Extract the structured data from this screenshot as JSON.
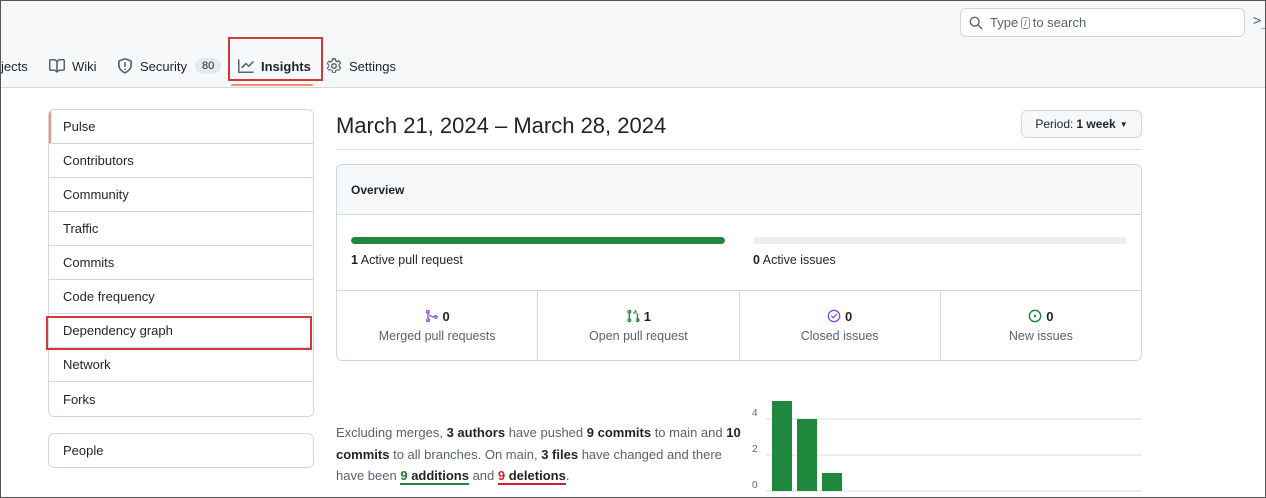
{
  "header": {
    "search": {
      "before": "Type",
      "key": "/",
      "after": "to search"
    },
    "command_glyph": ">_"
  },
  "tabs": [
    {
      "label": "Projects",
      "visible_label": "jects"
    },
    {
      "label": "Wiki"
    },
    {
      "label": "Security",
      "counter": "80"
    },
    {
      "label": "Insights",
      "selected": true
    },
    {
      "label": "Settings"
    }
  ],
  "sidebar": {
    "items": [
      {
        "label": "Pulse",
        "selected": true
      },
      {
        "label": "Contributors"
      },
      {
        "label": "Community"
      },
      {
        "label": "Traffic"
      },
      {
        "label": "Commits"
      },
      {
        "label": "Code frequency"
      },
      {
        "label": "Dependency graph"
      },
      {
        "label": "Network"
      },
      {
        "label": "Forks"
      }
    ],
    "people": "People"
  },
  "main": {
    "date_range": "March 21, 2024 – March 28, 2024",
    "period": {
      "label": "Period:",
      "value": "1 week"
    },
    "overview": {
      "title": "Overview",
      "pull_requests": {
        "count": "1",
        "label": "Active pull request",
        "fill": 1.0
      },
      "issues": {
        "count": "0",
        "label": "Active issues",
        "fill": 0.0
      },
      "stats": [
        {
          "count": "0",
          "label": "Merged pull requests",
          "icon": "git-merge-icon",
          "color": "#8250df"
        },
        {
          "count": "1",
          "label": "Open pull request",
          "icon": "git-pull-request-icon",
          "color": "#1a7f37"
        },
        {
          "count": "0",
          "label": "Closed issues",
          "icon": "issue-closed-icon",
          "color": "#8250df"
        },
        {
          "count": "0",
          "label": "New issues",
          "icon": "issue-opened-icon",
          "color": "#1a7f37"
        }
      ]
    },
    "summary": {
      "p1": "Excluding merges, ",
      "authors": "3 authors",
      "p2": " have pushed ",
      "commits_main": "9 commits",
      "p3": " to main and ",
      "commits_all": "10 commits",
      "p4": " to all branches. On main, ",
      "files": "3 files",
      "p5": " have changed and there have been ",
      "additions_num": "9",
      "additions_word": " additions",
      "p6": " and ",
      "deletions_num": "9",
      "deletions_word": " deletions",
      "p7": "."
    }
  },
  "chart_data": {
    "type": "bar",
    "y_ticks": [
      "4",
      "2",
      "0"
    ],
    "ylim": [
      0,
      5
    ],
    "values": [
      5,
      4,
      1
    ],
    "bar_color": "#1f883d",
    "grid": true
  }
}
